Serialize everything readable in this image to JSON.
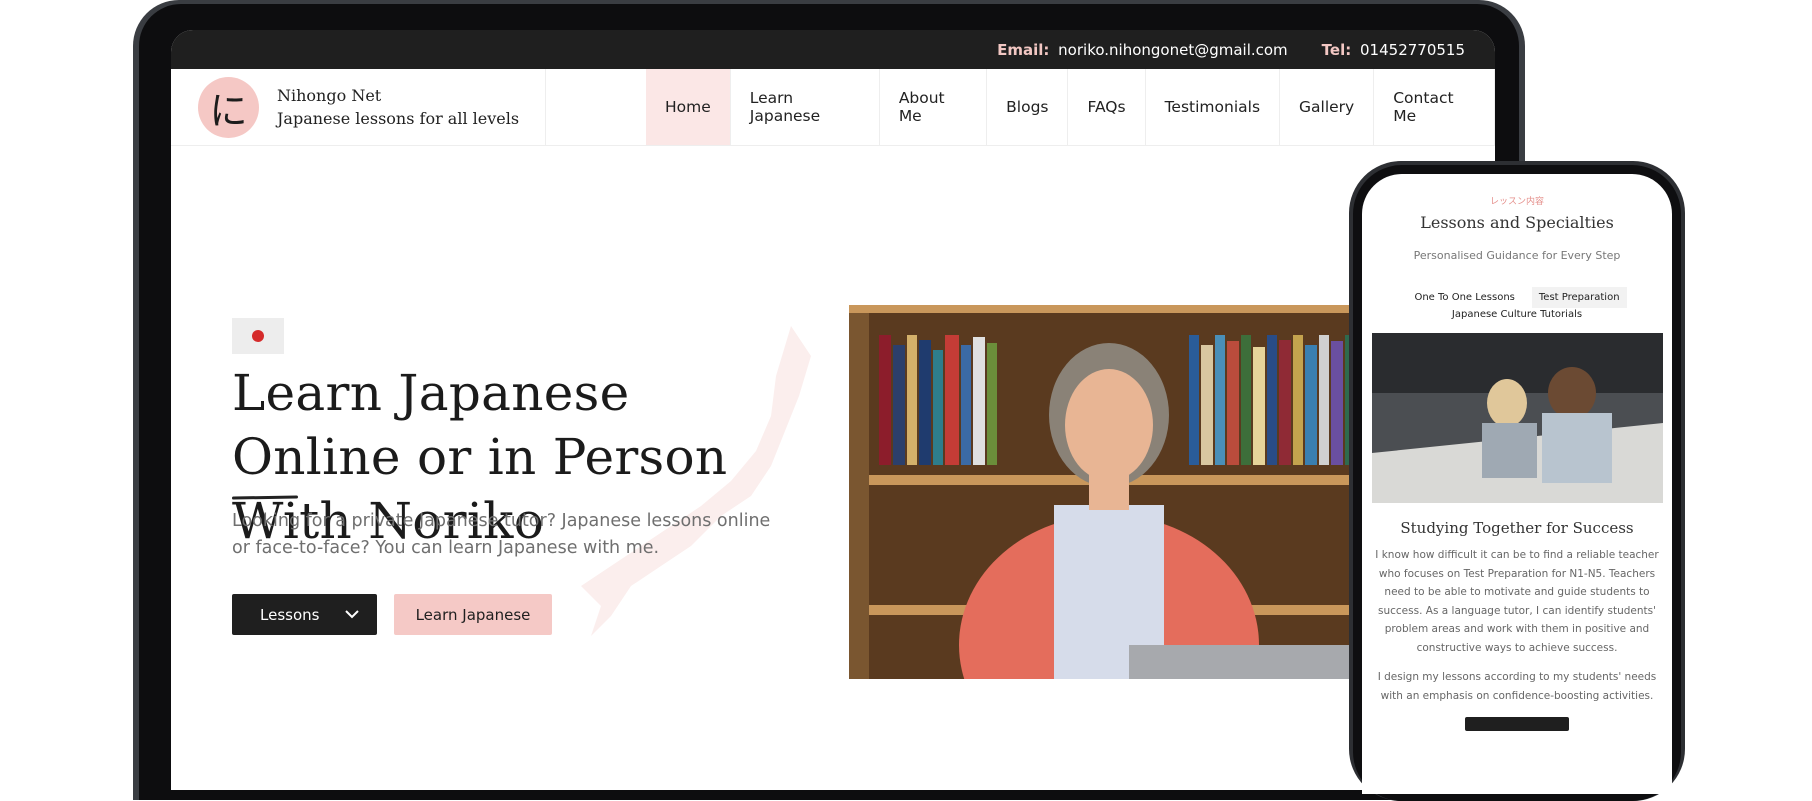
{
  "topbar": {
    "email_label": "Email:",
    "email_value": "noriko.nihongonet@gmail.com",
    "tel_label": "Tel:",
    "tel_value": "01452770515"
  },
  "brand": {
    "logo_glyph": "に",
    "name": "Nihongo Net",
    "tagline": "Japanese lessons for all levels"
  },
  "nav": {
    "items": [
      {
        "label": "Home",
        "active": true
      },
      {
        "label": "Learn Japanese"
      },
      {
        "label": "About Me"
      },
      {
        "label": "Blogs"
      },
      {
        "label": "FAQs"
      },
      {
        "label": "Testimonials"
      },
      {
        "label": "Gallery"
      },
      {
        "label": "Contact Me"
      }
    ]
  },
  "hero": {
    "heading": "Learn Japanese Online or in Person With Noriko",
    "description": "Looking for a private Japanese tutor? Japanese lessons online or face-to-face? You can learn Japanese with me.",
    "primary_button": "Lessons",
    "secondary_button": "Learn Japanese"
  },
  "phone": {
    "kicker": "レッスン内容",
    "title": "Lessons and Specialties",
    "subtitle": "Personalised Guidance for Every Step",
    "tabs": [
      "One To One Lessons",
      "Test Preparation",
      "Japanese Culture Tutorials"
    ],
    "section_title": "Studying Together for Success",
    "paragraph1": "I know how difficult it can be to find a reliable teacher who focuses on Test Preparation for N1-N5. Teachers need to be able to motivate and guide students to success. As a language tutor, I can identify students' problem areas and work with them in positive and constructive ways to achieve success.",
    "paragraph2": "I design my lessons according to my students' needs with an emphasis on confidence-boosting activities."
  },
  "colors": {
    "accent_pink": "#f5c9c6",
    "dark": "#1f1f1f",
    "flag_red": "#d52b2b"
  }
}
